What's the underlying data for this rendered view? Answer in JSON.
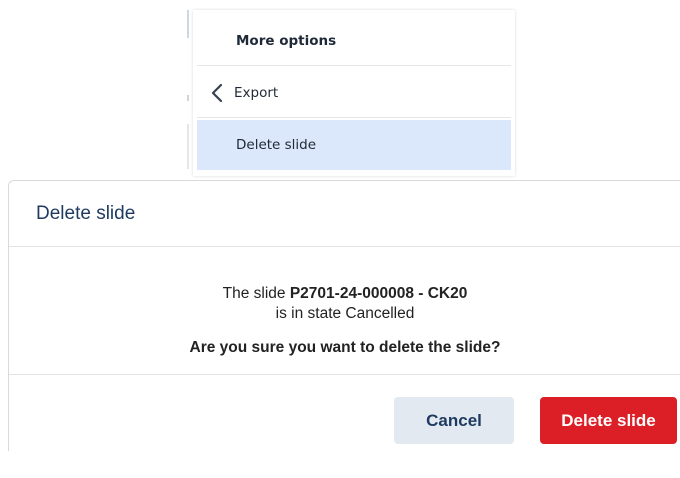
{
  "context_menu": {
    "header_label": "More options",
    "export_label": "Export",
    "delete_label": "Delete slide"
  },
  "dialog": {
    "title": "Delete slide",
    "message_prefix": "The slide",
    "slide_id": "P2701-24-000008 - CK20",
    "state_text": "is in state Cancelled",
    "question": "Are you sure you want to delete the slide?",
    "cancel_label": "Cancel",
    "delete_label": "Delete slide"
  },
  "colors": {
    "menu_highlight": "#dbe7fa",
    "title": "#1f3a5f",
    "cancel_bg": "#e3e9f1",
    "delete_bg": "#dc1f26"
  },
  "icons": {
    "export_back": "chevron-left-icon"
  }
}
